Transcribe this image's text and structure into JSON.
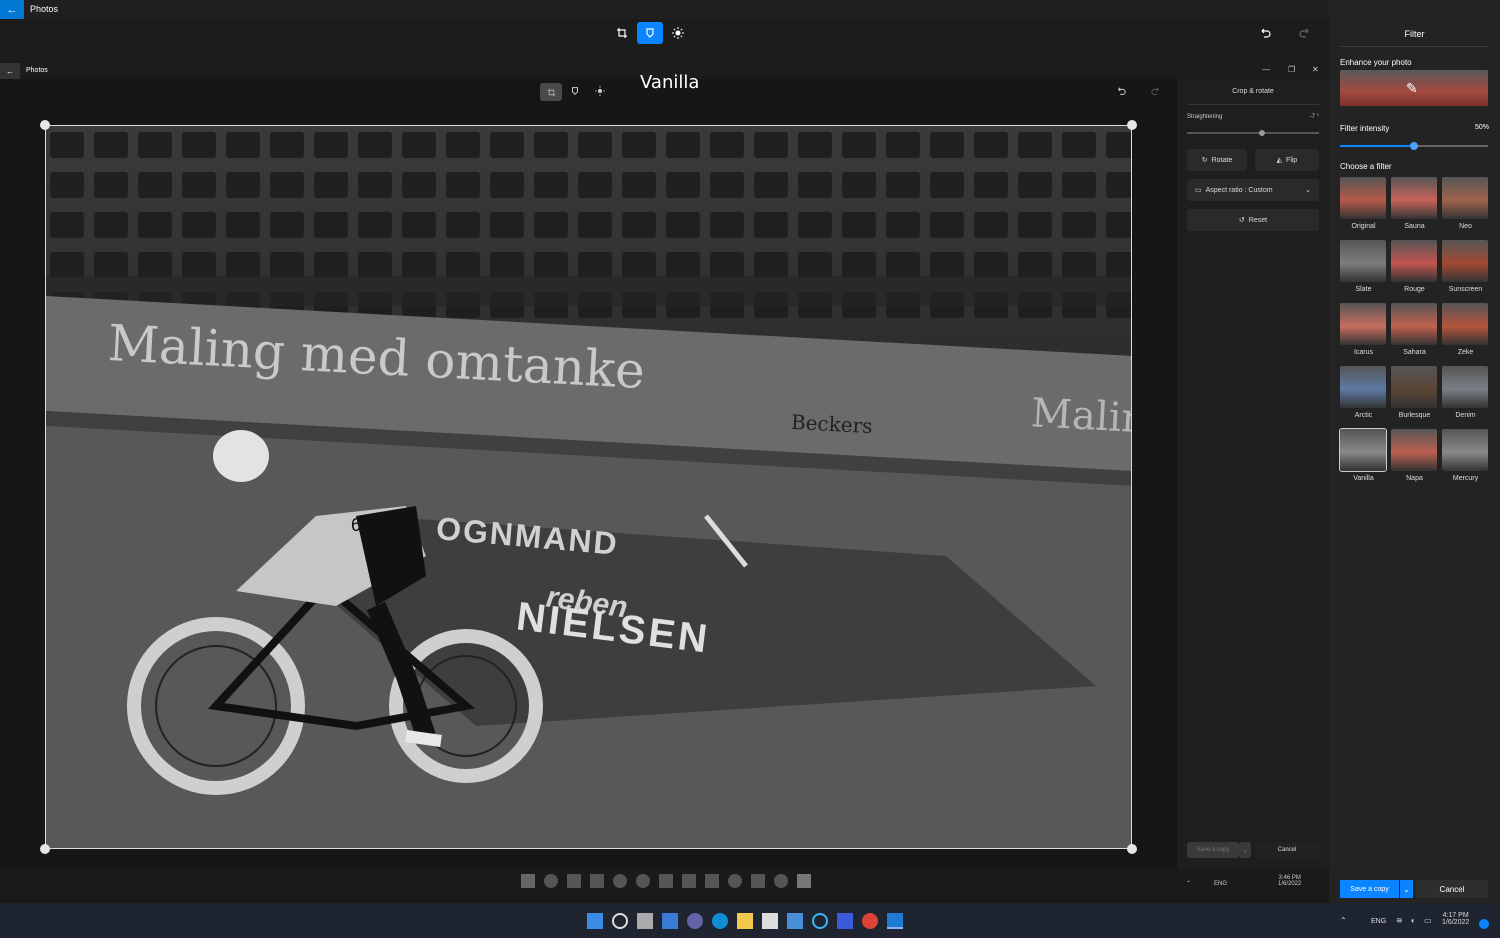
{
  "window": {
    "app_title": "Photos",
    "controls": [
      "—",
      "❐",
      "✕"
    ]
  },
  "toolbar": {
    "tools": [
      "crop-icon",
      "filter-icon",
      "adjust-icon"
    ],
    "active_tool": "filter",
    "accent": "#0a84ff"
  },
  "inner_window": {
    "app_title": "Photos",
    "filter_name": "Vanilla"
  },
  "photo": {
    "banner_text": "Maling med omtanke",
    "sponsor_text": "Beckers",
    "floor_text_top": "OGNMAND",
    "floor_text_logo": "reben",
    "floor_text_bottom": "NIELSEN",
    "banner_right": "Maling",
    "rider_number": "6"
  },
  "crop_panel": {
    "title": "Crop & rotate",
    "straightening_label": "Straightening",
    "straightening_value": "-7 °",
    "straightening_level": 0.57,
    "rotate_label": "Rotate",
    "flip_label": "Flip",
    "aspect_label": "Aspect ratio : Custom",
    "reset_label": "Reset",
    "save_label": "Save a copy",
    "cancel_label": "Cancel"
  },
  "inner_taskbar": {
    "tray_lang": "ENG",
    "time": "3:46 PM",
    "date": "1/6/2022"
  },
  "filter_panel": {
    "title": "Filter",
    "enhance_label": "Enhance your photo",
    "intensity_label": "Filter intensity",
    "intensity_value": "50%",
    "intensity_level": 0.5,
    "choose_label": "Choose a filter",
    "filters": [
      {
        "name": "Original",
        "tint": "#b55a4a"
      },
      {
        "name": "Sauna",
        "tint": "#c7645a"
      },
      {
        "name": "Neo",
        "tint": "#a0644d"
      },
      {
        "name": "Slate",
        "tint": "#7d7d7d"
      },
      {
        "name": "Rouge",
        "tint": "#c2554f"
      },
      {
        "name": "Sunscreen",
        "tint": "#a24a34"
      },
      {
        "name": "Icarus",
        "tint": "#c76e5e"
      },
      {
        "name": "Sahara",
        "tint": "#c0614e"
      },
      {
        "name": "Zeke",
        "tint": "#b5553e"
      },
      {
        "name": "Arctic",
        "tint": "#5e7aa5"
      },
      {
        "name": "Burlesque",
        "tint": "#5a4535"
      },
      {
        "name": "Denim",
        "tint": "#7a7f86"
      },
      {
        "name": "Vanilla",
        "tint": "#888888"
      },
      {
        "name": "Napa",
        "tint": "#b9604f"
      },
      {
        "name": "Mercury",
        "tint": "#8a8a8a"
      }
    ],
    "save_label": "Save a copy",
    "cancel_label": "Cancel"
  },
  "taskbar": {
    "lang": "ENG",
    "time": "4:17 PM",
    "date": "1/6/2022"
  }
}
